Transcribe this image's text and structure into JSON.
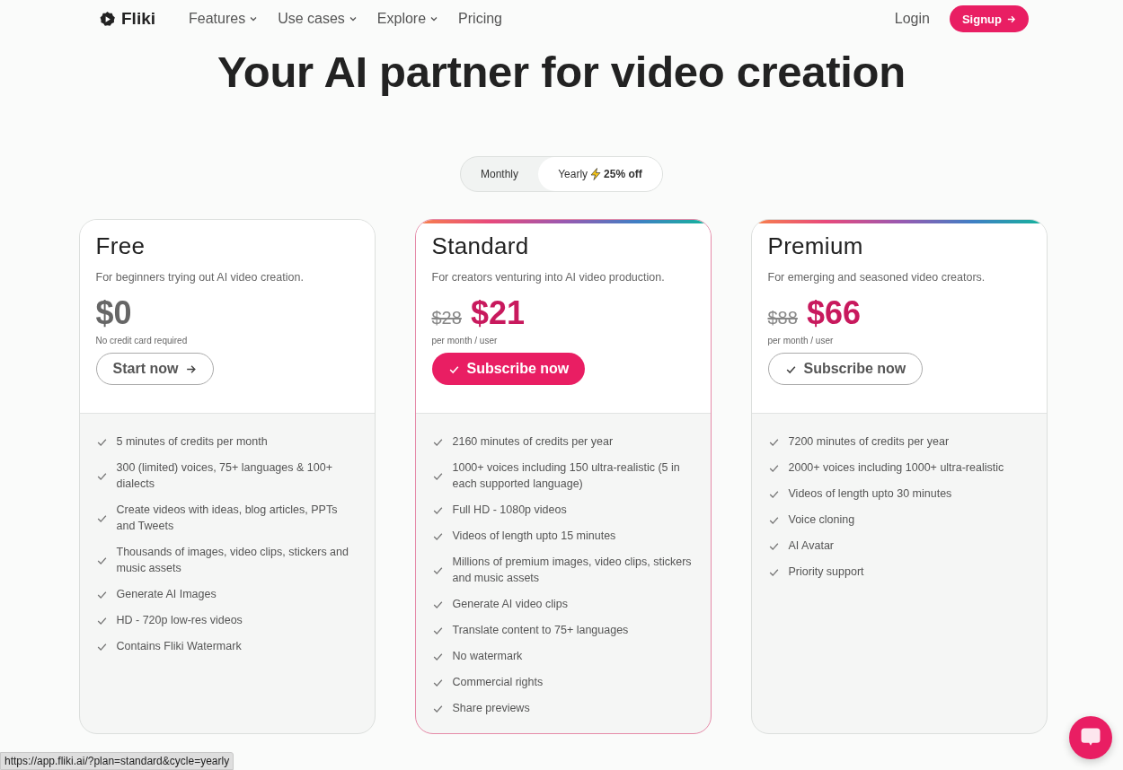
{
  "nav": {
    "logo": "Fliki",
    "links": [
      {
        "label": "Features",
        "dropdown": true
      },
      {
        "label": "Use cases",
        "dropdown": true
      },
      {
        "label": "Explore",
        "dropdown": true
      },
      {
        "label": "Pricing",
        "dropdown": false
      }
    ],
    "login": "Login",
    "signup": "Signup"
  },
  "hero": {
    "title": "Your AI partner for video creation"
  },
  "billing_toggle": [
    {
      "label": "Monthly",
      "selected": false
    },
    {
      "label": "Yearly",
      "badge": "25% off",
      "selected": true
    }
  ],
  "plans": [
    {
      "name": "Free",
      "description": "For beginners trying out AI video creation.",
      "price": "$0",
      "note": "No credit card required",
      "accent_bar": false,
      "highlighted": false,
      "button": {
        "kind": "outline-arrow",
        "label": "Start now"
      },
      "features": [
        "5 minutes of credits per month",
        "300 (limited) voices, 75+ languages & 100+ dialects",
        "Create videos with ideas, blog articles, PPTs and Tweets",
        "Thousands of images, video clips, stickers and music assets",
        "Generate AI Images",
        "HD - 720p low-res videos",
        "Contains Fliki Watermark"
      ]
    },
    {
      "name": "Standard",
      "description": "For creators venturing into AI video production.",
      "old_price": "$28",
      "price": "$21",
      "note": "per month / user",
      "accent_bar": true,
      "highlighted": true,
      "button": {
        "kind": "primary-check",
        "label": "Subscribe now"
      },
      "features": [
        "2160 minutes of credits per year",
        "1000+ voices including 150 ultra-realistic (5 in each supported language)",
        "Full HD - 1080p videos",
        "Videos of length upto 15 minutes",
        "Millions of premium images, video clips, stickers and music assets",
        "Generate AI video clips",
        "Translate content to 75+ languages",
        "No watermark",
        "Commercial rights",
        "Share previews"
      ]
    },
    {
      "name": "Premium",
      "description": "For emerging and seasoned video creators.",
      "old_price": "$88",
      "price": "$66",
      "note": "per month / user",
      "accent_bar": true,
      "highlighted": false,
      "button": {
        "kind": "outline-check",
        "label": "Subscribe now"
      },
      "features": [
        "7200 minutes of credits per year",
        "2000+ voices including 1000+ ultra-realistic",
        "Videos of length upto 30 minutes",
        "Voice cloning",
        "AI Avatar",
        "Priority support"
      ]
    }
  ],
  "status_url": "https://app.fliki.ai/?plan=standard&cycle=yearly"
}
